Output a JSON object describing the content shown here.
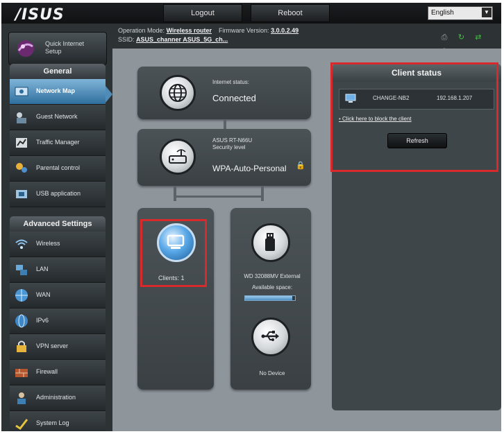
{
  "header": {
    "logo": "/ISUS",
    "logout": "Logout",
    "reboot": "Reboot",
    "language": "English"
  },
  "info": {
    "op_mode_label": "Operation Mode:",
    "op_mode_value": "Wireless router",
    "firmware_label": "Firmware Version:",
    "firmware_value": "3.0.0.2.49",
    "ssid_label": "SSID:",
    "ssid_values": "ASUS_channer  ASUS_5G_ch..."
  },
  "sidebar": {
    "quick_setup": "Quick Internet Setup",
    "general_header": "General",
    "general_items": [
      {
        "label": "Network Map",
        "icon": "network-map-icon",
        "active": true
      },
      {
        "label": "Guest Network",
        "icon": "guest-network-icon"
      },
      {
        "label": "Traffic Manager",
        "icon": "traffic-manager-icon"
      },
      {
        "label": "Parental control",
        "icon": "parental-control-icon"
      },
      {
        "label": "USB application",
        "icon": "usb-application-icon"
      }
    ],
    "advanced_header": "Advanced Settings",
    "advanced_items": [
      {
        "label": "Wireless",
        "icon": "wireless-icon"
      },
      {
        "label": "LAN",
        "icon": "lan-icon"
      },
      {
        "label": "WAN",
        "icon": "wan-icon"
      },
      {
        "label": "IPv6",
        "icon": "ipv6-icon"
      },
      {
        "label": "VPN server",
        "icon": "vpn-server-icon"
      },
      {
        "label": "Firewall",
        "icon": "firewall-icon"
      },
      {
        "label": "Administration",
        "icon": "administration-icon"
      },
      {
        "label": "System Log",
        "icon": "system-log-icon"
      }
    ]
  },
  "map": {
    "internet_status_label": "Internet status:",
    "internet_status_value": "Connected",
    "router_model": "ASUS RT-N66U",
    "security_label": "Security level",
    "security_value": "WPA-Auto-Personal",
    "clients_label": "Clients: 1",
    "usb_device": "WD 32088MV External",
    "available_space_label": "Available space:",
    "available_space_fraction": 0.95,
    "usb2_status": "No Device"
  },
  "client_status": {
    "title": "Client status",
    "client_name": "CHANGE-NB2",
    "client_ip": "192.168.1.207",
    "block_link": "Click here to block the client",
    "refresh": "Refresh"
  }
}
